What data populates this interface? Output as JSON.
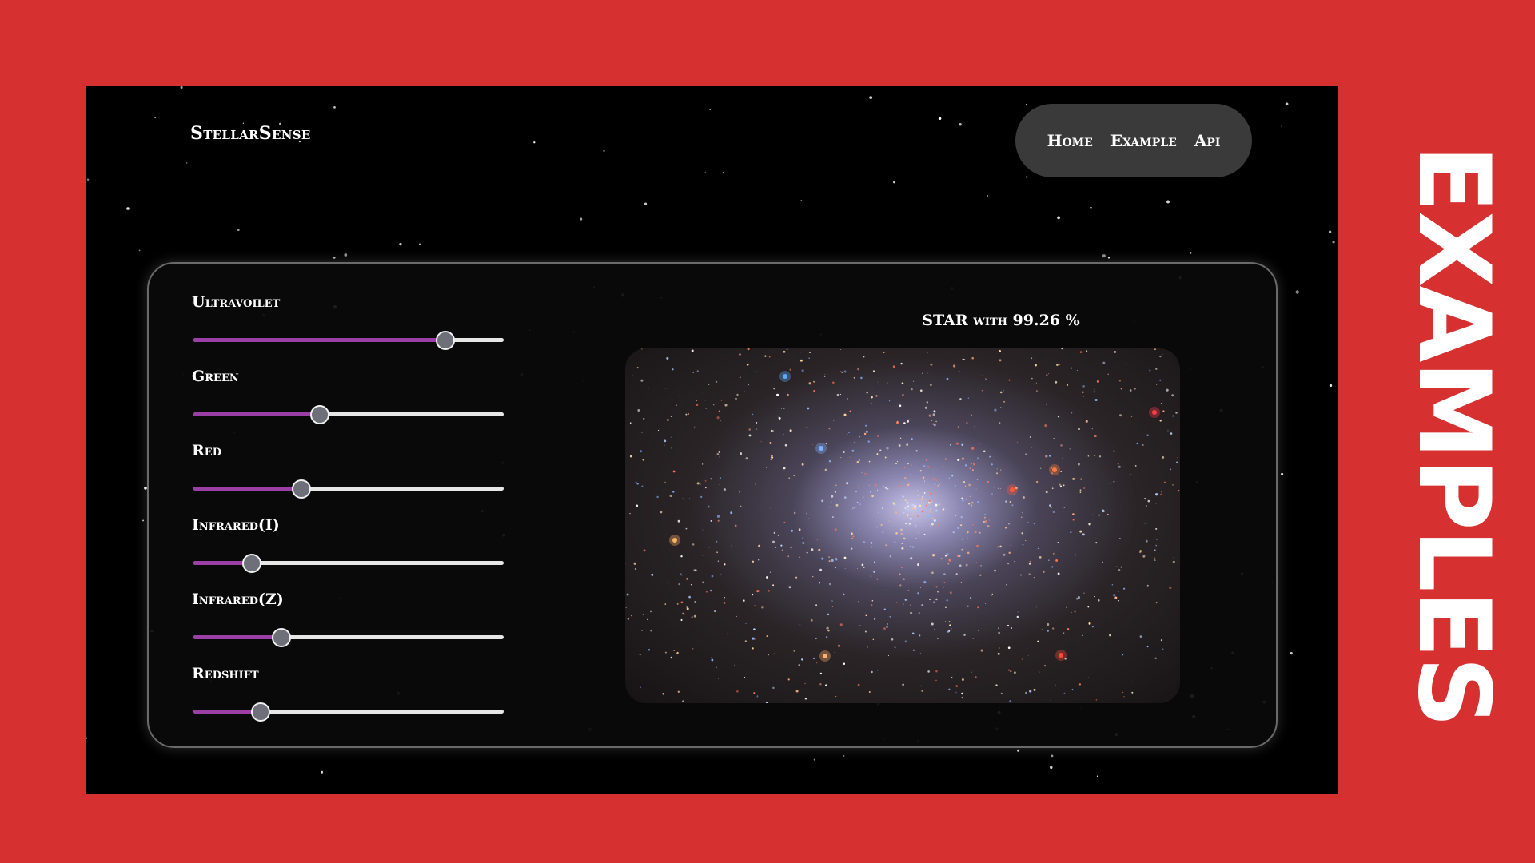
{
  "app": {
    "brand": "StellarSense"
  },
  "nav": {
    "items": [
      {
        "label": "Home"
      },
      {
        "label": "Example"
      },
      {
        "label": "Api"
      }
    ]
  },
  "controls": [
    {
      "label": "Ultravoilet",
      "value": 0.81
    },
    {
      "label": "Green",
      "value": 0.405
    },
    {
      "label": "Red",
      "value": 0.345
    },
    {
      "label": "Infrared(I)",
      "value": 0.185
    },
    {
      "label": "Infrared(Z)",
      "value": 0.28
    },
    {
      "label": "Redshift",
      "value": 0.215
    }
  ],
  "result": {
    "text": "STAR with 99.26 %"
  },
  "side_title": "EXAMPLES",
  "colors": {
    "background": "#d63031",
    "accent": "#9b3fa6",
    "nav_background": "#3a3a3a"
  }
}
